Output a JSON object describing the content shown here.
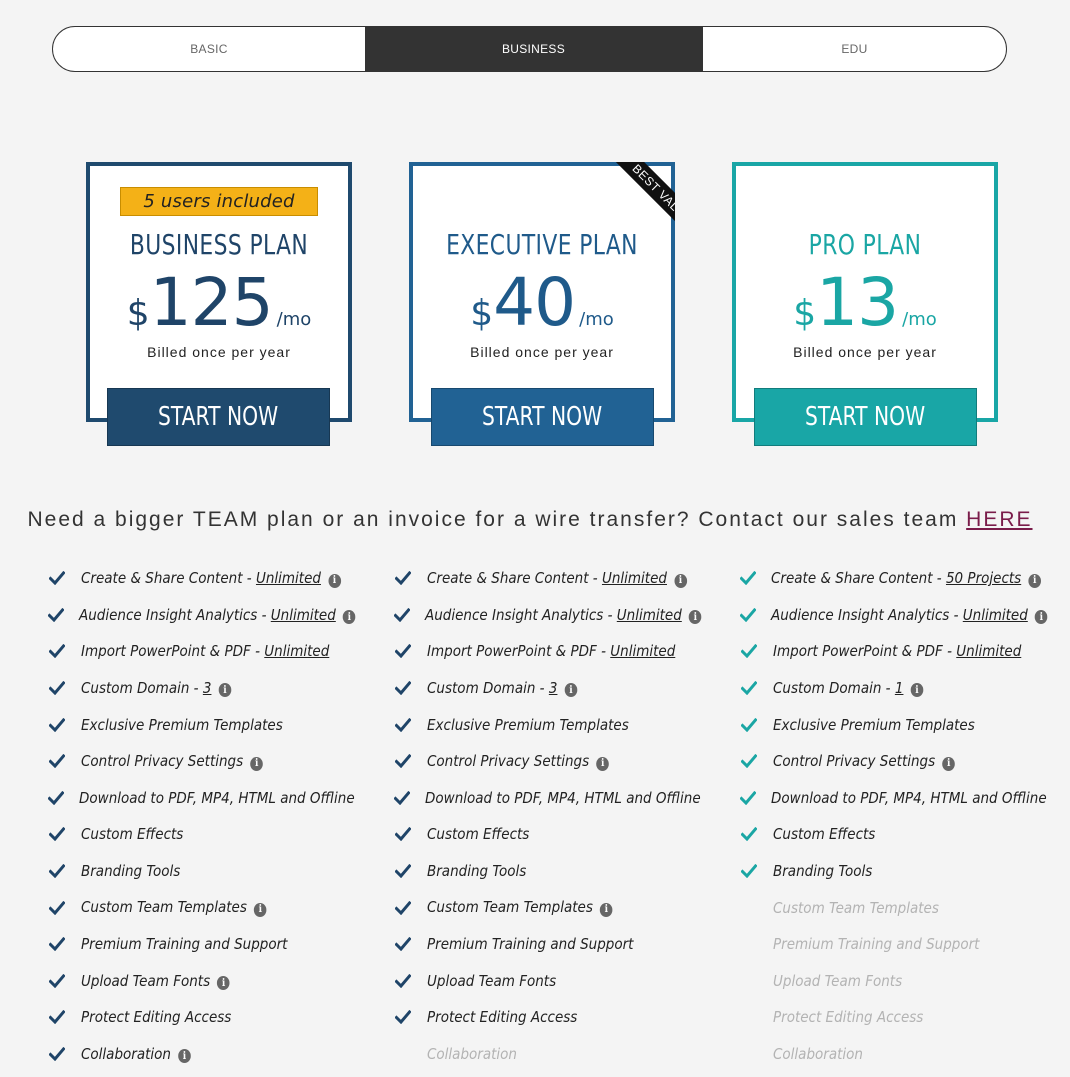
{
  "tabs": [
    "BASIC",
    "BUSINESS",
    "EDU"
  ],
  "plans": [
    {
      "badge": "5 users included",
      "title": "BUSINESS PLAN",
      "currency": "$",
      "price": "125",
      "period": "/mo",
      "billed": "Billed once per year",
      "cta": "START NOW",
      "color": "#1f4a6e"
    },
    {
      "ribbon": "BEST VALUE",
      "title": "EXECUTIVE PLAN",
      "currency": "$",
      "price": "40",
      "period": "/mo",
      "billed": "Billed once per year",
      "cta": "START NOW",
      "color": "#216294"
    },
    {
      "title": "PRO PLAN",
      "currency": "$",
      "price": "13",
      "period": "/mo",
      "billed": "Billed once per year",
      "cta": "START NOW",
      "color": "#19a6a6"
    }
  ],
  "contact": {
    "text": "Need a bigger TEAM plan or an invoice for a wire transfer? Contact our sales team",
    "link": "HERE"
  },
  "features": [
    [
      {
        "label": "Create & Share Content - ",
        "value": "Unlimited",
        "info": true,
        "enabled": true
      },
      {
        "label": "Audience Insight Analytics - ",
        "value": "Unlimited",
        "info": true,
        "enabled": true
      },
      {
        "label": "Import PowerPoint & PDF - ",
        "value": "Unlimited",
        "info": false,
        "enabled": true
      },
      {
        "label": "Custom Domain - ",
        "value": "3",
        "info": true,
        "enabled": true
      },
      {
        "label": "Exclusive Premium Templates",
        "info": false,
        "enabled": true
      },
      {
        "label": "Control Privacy Settings",
        "info": true,
        "enabled": true
      },
      {
        "label": "Download to PDF, MP4, HTML and Offline",
        "info": false,
        "enabled": true
      },
      {
        "label": "Custom Effects",
        "info": false,
        "enabled": true
      },
      {
        "label": "Branding Tools",
        "info": false,
        "enabled": true
      },
      {
        "label": "Custom Team Templates",
        "info": true,
        "enabled": true
      },
      {
        "label": "Premium Training and Support",
        "info": false,
        "enabled": true
      },
      {
        "label": "Upload Team Fonts",
        "info": true,
        "enabled": true
      },
      {
        "label": "Protect Editing Access",
        "info": false,
        "enabled": true
      },
      {
        "label": "Collaboration",
        "info": true,
        "enabled": true
      }
    ],
    [
      {
        "label": "Create & Share Content - ",
        "value": "Unlimited",
        "info": true,
        "enabled": true
      },
      {
        "label": "Audience Insight Analytics - ",
        "value": "Unlimited",
        "info": true,
        "enabled": true
      },
      {
        "label": "Import PowerPoint & PDF - ",
        "value": "Unlimited",
        "info": false,
        "enabled": true
      },
      {
        "label": "Custom Domain - ",
        "value": "3",
        "info": true,
        "enabled": true
      },
      {
        "label": "Exclusive Premium Templates",
        "info": false,
        "enabled": true
      },
      {
        "label": "Control Privacy Settings",
        "info": true,
        "enabled": true
      },
      {
        "label": "Download to PDF, MP4, HTML and Offline",
        "info": false,
        "enabled": true
      },
      {
        "label": "Custom Effects",
        "info": false,
        "enabled": true
      },
      {
        "label": "Branding Tools",
        "info": false,
        "enabled": true
      },
      {
        "label": "Custom Team Templates",
        "info": true,
        "enabled": true
      },
      {
        "label": "Premium Training and Support",
        "info": false,
        "enabled": true
      },
      {
        "label": "Upload Team Fonts",
        "info": false,
        "enabled": true
      },
      {
        "label": "Protect Editing Access",
        "info": false,
        "enabled": true
      },
      {
        "label": "Collaboration",
        "info": false,
        "enabled": false
      }
    ],
    [
      {
        "label": "Create & Share Content - ",
        "value": "50 Projects",
        "info": true,
        "enabled": true
      },
      {
        "label": "Audience Insight Analytics - ",
        "value": "Unlimited",
        "info": true,
        "enabled": true
      },
      {
        "label": "Import PowerPoint & PDF - ",
        "value": "Unlimited",
        "info": false,
        "enabled": true
      },
      {
        "label": "Custom Domain - ",
        "value": "1",
        "info": true,
        "enabled": true
      },
      {
        "label": "Exclusive Premium Templates",
        "info": false,
        "enabled": true
      },
      {
        "label": "Control Privacy Settings",
        "info": true,
        "enabled": true
      },
      {
        "label": "Download to PDF, MP4, HTML and Offline",
        "info": false,
        "enabled": true
      },
      {
        "label": "Custom Effects",
        "info": false,
        "enabled": true
      },
      {
        "label": "Branding Tools",
        "info": false,
        "enabled": true
      },
      {
        "label": "Custom Team Templates",
        "info": false,
        "enabled": false
      },
      {
        "label": "Premium Training and Support",
        "info": false,
        "enabled": false
      },
      {
        "label": "Upload Team Fonts",
        "info": false,
        "enabled": false
      },
      {
        "label": "Protect Editing Access",
        "info": false,
        "enabled": false
      },
      {
        "label": "Collaboration",
        "info": false,
        "enabled": false
      }
    ]
  ],
  "icons": {
    "check": "check-icon",
    "info": "info-icon"
  },
  "colors": {
    "dark": "#1f4468",
    "teal": "#1aa6a4",
    "accent": "#f4b117",
    "link": "#7a1c4a"
  }
}
